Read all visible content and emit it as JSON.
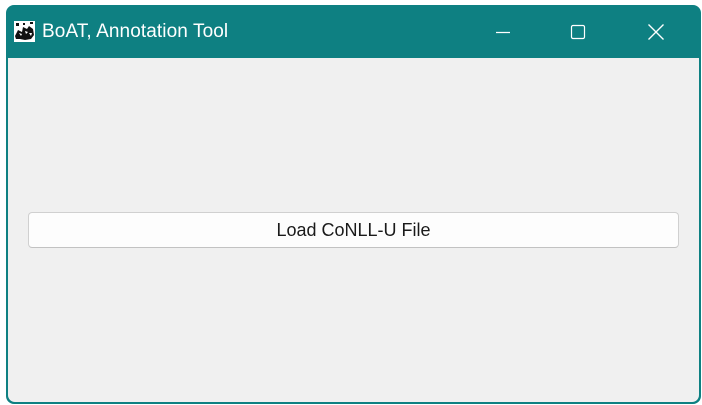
{
  "window": {
    "title": "BoAT, Annotation Tool",
    "title_bar_color": "#0e8082",
    "app_icon": "boat-app-icon",
    "controls": [
      {
        "name": "minimize",
        "icon": "minimize-icon"
      },
      {
        "name": "maximize",
        "icon": "maximize-icon"
      },
      {
        "name": "close",
        "icon": "close-icon"
      }
    ]
  },
  "main": {
    "load_button_label": "Load CoNLL-U File"
  }
}
